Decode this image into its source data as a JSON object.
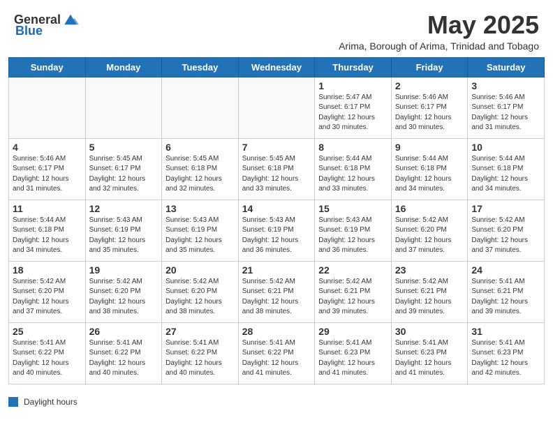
{
  "header": {
    "logo_general": "General",
    "logo_blue": "Blue",
    "month_title": "May 2025",
    "subtitle": "Arima, Borough of Arima, Trinidad and Tobago"
  },
  "days": [
    "Sunday",
    "Monday",
    "Tuesday",
    "Wednesday",
    "Thursday",
    "Friday",
    "Saturday"
  ],
  "weeks": [
    [
      {
        "day": "",
        "text": ""
      },
      {
        "day": "",
        "text": ""
      },
      {
        "day": "",
        "text": ""
      },
      {
        "day": "",
        "text": ""
      },
      {
        "day": "1",
        "text": "Sunrise: 5:47 AM\nSunset: 6:17 PM\nDaylight: 12 hours\nand 30 minutes."
      },
      {
        "day": "2",
        "text": "Sunrise: 5:46 AM\nSunset: 6:17 PM\nDaylight: 12 hours\nand 30 minutes."
      },
      {
        "day": "3",
        "text": "Sunrise: 5:46 AM\nSunset: 6:17 PM\nDaylight: 12 hours\nand 31 minutes."
      }
    ],
    [
      {
        "day": "4",
        "text": "Sunrise: 5:46 AM\nSunset: 6:17 PM\nDaylight: 12 hours\nand 31 minutes."
      },
      {
        "day": "5",
        "text": "Sunrise: 5:45 AM\nSunset: 6:17 PM\nDaylight: 12 hours\nand 32 minutes."
      },
      {
        "day": "6",
        "text": "Sunrise: 5:45 AM\nSunset: 6:18 PM\nDaylight: 12 hours\nand 32 minutes."
      },
      {
        "day": "7",
        "text": "Sunrise: 5:45 AM\nSunset: 6:18 PM\nDaylight: 12 hours\nand 33 minutes."
      },
      {
        "day": "8",
        "text": "Sunrise: 5:44 AM\nSunset: 6:18 PM\nDaylight: 12 hours\nand 33 minutes."
      },
      {
        "day": "9",
        "text": "Sunrise: 5:44 AM\nSunset: 6:18 PM\nDaylight: 12 hours\nand 34 minutes."
      },
      {
        "day": "10",
        "text": "Sunrise: 5:44 AM\nSunset: 6:18 PM\nDaylight: 12 hours\nand 34 minutes."
      }
    ],
    [
      {
        "day": "11",
        "text": "Sunrise: 5:44 AM\nSunset: 6:18 PM\nDaylight: 12 hours\nand 34 minutes."
      },
      {
        "day": "12",
        "text": "Sunrise: 5:43 AM\nSunset: 6:19 PM\nDaylight: 12 hours\nand 35 minutes."
      },
      {
        "day": "13",
        "text": "Sunrise: 5:43 AM\nSunset: 6:19 PM\nDaylight: 12 hours\nand 35 minutes."
      },
      {
        "day": "14",
        "text": "Sunrise: 5:43 AM\nSunset: 6:19 PM\nDaylight: 12 hours\nand 36 minutes."
      },
      {
        "day": "15",
        "text": "Sunrise: 5:43 AM\nSunset: 6:19 PM\nDaylight: 12 hours\nand 36 minutes."
      },
      {
        "day": "16",
        "text": "Sunrise: 5:42 AM\nSunset: 6:20 PM\nDaylight: 12 hours\nand 37 minutes."
      },
      {
        "day": "17",
        "text": "Sunrise: 5:42 AM\nSunset: 6:20 PM\nDaylight: 12 hours\nand 37 minutes."
      }
    ],
    [
      {
        "day": "18",
        "text": "Sunrise: 5:42 AM\nSunset: 6:20 PM\nDaylight: 12 hours\nand 37 minutes."
      },
      {
        "day": "19",
        "text": "Sunrise: 5:42 AM\nSunset: 6:20 PM\nDaylight: 12 hours\nand 38 minutes."
      },
      {
        "day": "20",
        "text": "Sunrise: 5:42 AM\nSunset: 6:20 PM\nDaylight: 12 hours\nand 38 minutes."
      },
      {
        "day": "21",
        "text": "Sunrise: 5:42 AM\nSunset: 6:21 PM\nDaylight: 12 hours\nand 38 minutes."
      },
      {
        "day": "22",
        "text": "Sunrise: 5:42 AM\nSunset: 6:21 PM\nDaylight: 12 hours\nand 39 minutes."
      },
      {
        "day": "23",
        "text": "Sunrise: 5:42 AM\nSunset: 6:21 PM\nDaylight: 12 hours\nand 39 minutes."
      },
      {
        "day": "24",
        "text": "Sunrise: 5:41 AM\nSunset: 6:21 PM\nDaylight: 12 hours\nand 39 minutes."
      }
    ],
    [
      {
        "day": "25",
        "text": "Sunrise: 5:41 AM\nSunset: 6:22 PM\nDaylight: 12 hours\nand 40 minutes."
      },
      {
        "day": "26",
        "text": "Sunrise: 5:41 AM\nSunset: 6:22 PM\nDaylight: 12 hours\nand 40 minutes."
      },
      {
        "day": "27",
        "text": "Sunrise: 5:41 AM\nSunset: 6:22 PM\nDaylight: 12 hours\nand 40 minutes."
      },
      {
        "day": "28",
        "text": "Sunrise: 5:41 AM\nSunset: 6:22 PM\nDaylight: 12 hours\nand 41 minutes."
      },
      {
        "day": "29",
        "text": "Sunrise: 5:41 AM\nSunset: 6:23 PM\nDaylight: 12 hours\nand 41 minutes."
      },
      {
        "day": "30",
        "text": "Sunrise: 5:41 AM\nSunset: 6:23 PM\nDaylight: 12 hours\nand 41 minutes."
      },
      {
        "day": "31",
        "text": "Sunrise: 5:41 AM\nSunset: 6:23 PM\nDaylight: 12 hours\nand 42 minutes."
      }
    ]
  ],
  "legend": {
    "label": "Daylight hours"
  }
}
